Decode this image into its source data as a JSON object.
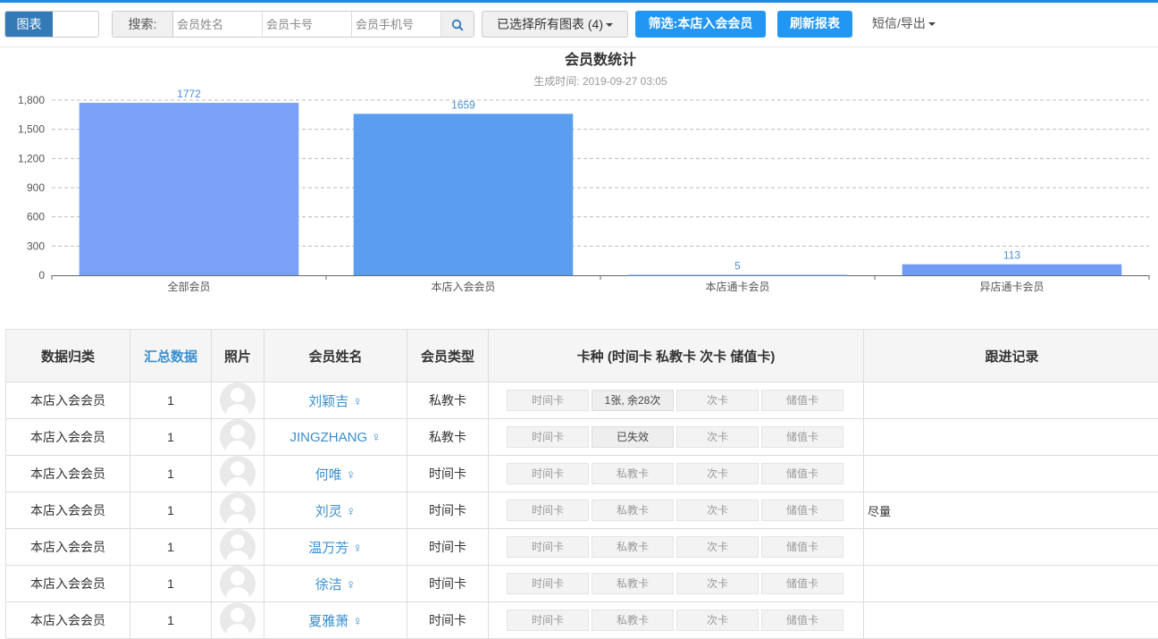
{
  "toolbar": {
    "view_label": "图表",
    "search_label": "搜索:",
    "name_placeholder": "会员姓名",
    "card_placeholder": "会员卡号",
    "phone_placeholder": "会员手机号",
    "select_label": "已选择所有图表 (4)",
    "filter_label": "筛选:本店入会会员",
    "refresh_label": "刷新报表",
    "sms_label": "短信/导出"
  },
  "chart_data": {
    "type": "bar",
    "title": "会员数统计",
    "subtitle": "生成时间: 2019-09-27 03:05",
    "categories": [
      "全部会员",
      "本店入会会员",
      "本店通卡会员",
      "异店通卡会员"
    ],
    "values": [
      1772,
      1659,
      5,
      113
    ],
    "value_labels": [
      "1772",
      "1659",
      "5",
      "113"
    ],
    "yticks": [
      "0",
      "300",
      "600",
      "900",
      "1,200",
      "1,500",
      "1,800"
    ],
    "ylim": [
      0,
      1800
    ],
    "colors": [
      "#7aa1f5",
      "#5a9ef2",
      "#6aa7f0",
      "#6f9df5"
    ],
    "grid": true
  },
  "table": {
    "headers": [
      "数据归类",
      "汇总数据",
      "照片",
      "会员姓名",
      "会员类型",
      "卡种 (时间卡 私教卡 次卡 储值卡)",
      "跟进记录"
    ],
    "rows": [
      {
        "category": "本店入会会员",
        "count": "1",
        "name": "刘颖吉 ♀",
        "type": "私教卡",
        "cards": [
          "时间卡",
          "1张, 余28次",
          "次卡",
          "储值卡"
        ],
        "active": 1,
        "follow": ""
      },
      {
        "category": "本店入会会员",
        "count": "1",
        "name": "JINGZHANG ♀",
        "type": "私教卡",
        "cards": [
          "时间卡",
          "已失效",
          "次卡",
          "储值卡"
        ],
        "active": 1,
        "follow": ""
      },
      {
        "category": "本店入会会员",
        "count": "1",
        "name": "何唯 ♀",
        "type": "时间卡",
        "cards": [
          "时间卡",
          "私教卡",
          "次卡",
          "储值卡"
        ],
        "active": -1,
        "follow": ""
      },
      {
        "category": "本店入会会员",
        "count": "1",
        "name": "刘灵 ♀",
        "type": "时间卡",
        "cards": [
          "时间卡",
          "私教卡",
          "次卡",
          "储值卡"
        ],
        "active": -1,
        "follow": "尽量"
      },
      {
        "category": "本店入会会员",
        "count": "1",
        "name": "温万芳 ♀",
        "type": "时间卡",
        "cards": [
          "时间卡",
          "私教卡",
          "次卡",
          "储值卡"
        ],
        "active": -1,
        "follow": ""
      },
      {
        "category": "本店入会会员",
        "count": "1",
        "name": "徐洁 ♀",
        "type": "时间卡",
        "cards": [
          "时间卡",
          "私教卡",
          "次卡",
          "储值卡"
        ],
        "active": -1,
        "follow": ""
      },
      {
        "category": "本店入会会员",
        "count": "1",
        "name": "夏雅萧 ♀",
        "type": "时间卡",
        "cards": [
          "时间卡",
          "私教卡",
          "次卡",
          "储值卡"
        ],
        "active": -1,
        "follow": ""
      }
    ]
  }
}
